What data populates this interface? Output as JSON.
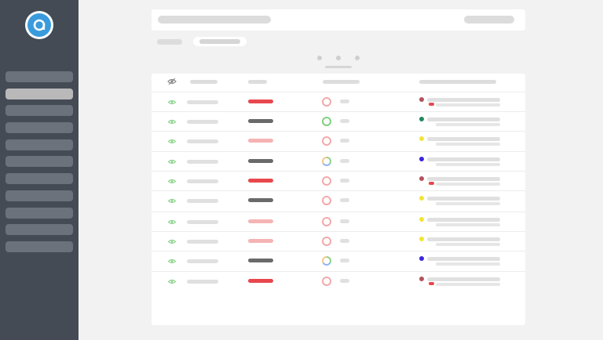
{
  "app": {
    "logo_icon": "circle-a-logo",
    "accent_color": "#3a9bdc",
    "sidebar_bg": "#454b55"
  },
  "sidebar": {
    "items": [
      {
        "active": false
      },
      {
        "active": true
      },
      {
        "active": false
      },
      {
        "active": false
      },
      {
        "active": false
      },
      {
        "active": false
      },
      {
        "active": false
      },
      {
        "active": false
      },
      {
        "active": false
      },
      {
        "active": false
      },
      {
        "active": false
      }
    ]
  },
  "loading": {
    "state": "loading",
    "icon": "loading-dots-icon"
  },
  "table": {
    "columns": [
      {
        "icon": "eye-icon"
      },
      {
        "key": "name"
      },
      {
        "key": "status"
      },
      {
        "key": "progress"
      },
      {
        "key": "details"
      }
    ],
    "rows": [
      {
        "status_color": "#e8474d",
        "ring": "red",
        "dot_color": "#b3525c",
        "badge": true
      },
      {
        "status_color": "#6a6a6a",
        "ring": "green",
        "dot_color": "#1f8a5a",
        "badge": false
      },
      {
        "status_color": "#f5b3b3",
        "ring": "red",
        "dot_color": "#f2e533",
        "badge": false
      },
      {
        "status_color": "#6a6a6a",
        "ring": "multi",
        "dot_color": "#3a26e0",
        "badge": false
      },
      {
        "status_color": "#e8474d",
        "ring": "red",
        "dot_color": "#b3525c",
        "badge": true
      },
      {
        "status_color": "#6a6a6a",
        "ring": "red",
        "dot_color": "#f2e533",
        "badge": false
      },
      {
        "status_color": "#f5b3b3",
        "ring": "red",
        "dot_color": "#f2e533",
        "badge": false
      },
      {
        "status_color": "#f5b3b3",
        "ring": "red",
        "dot_color": "#f2e533",
        "badge": false
      },
      {
        "status_color": "#6a6a6a",
        "ring": "multi",
        "dot_color": "#3a26e0",
        "badge": false
      },
      {
        "status_color": "#e8474d",
        "ring": "red",
        "dot_color": "#b3525c",
        "badge": true
      }
    ]
  },
  "colors": {
    "ring_red": "#f4a9a9",
    "ring_green": "#7fd07f",
    "eye_green": "#8bd38b"
  }
}
